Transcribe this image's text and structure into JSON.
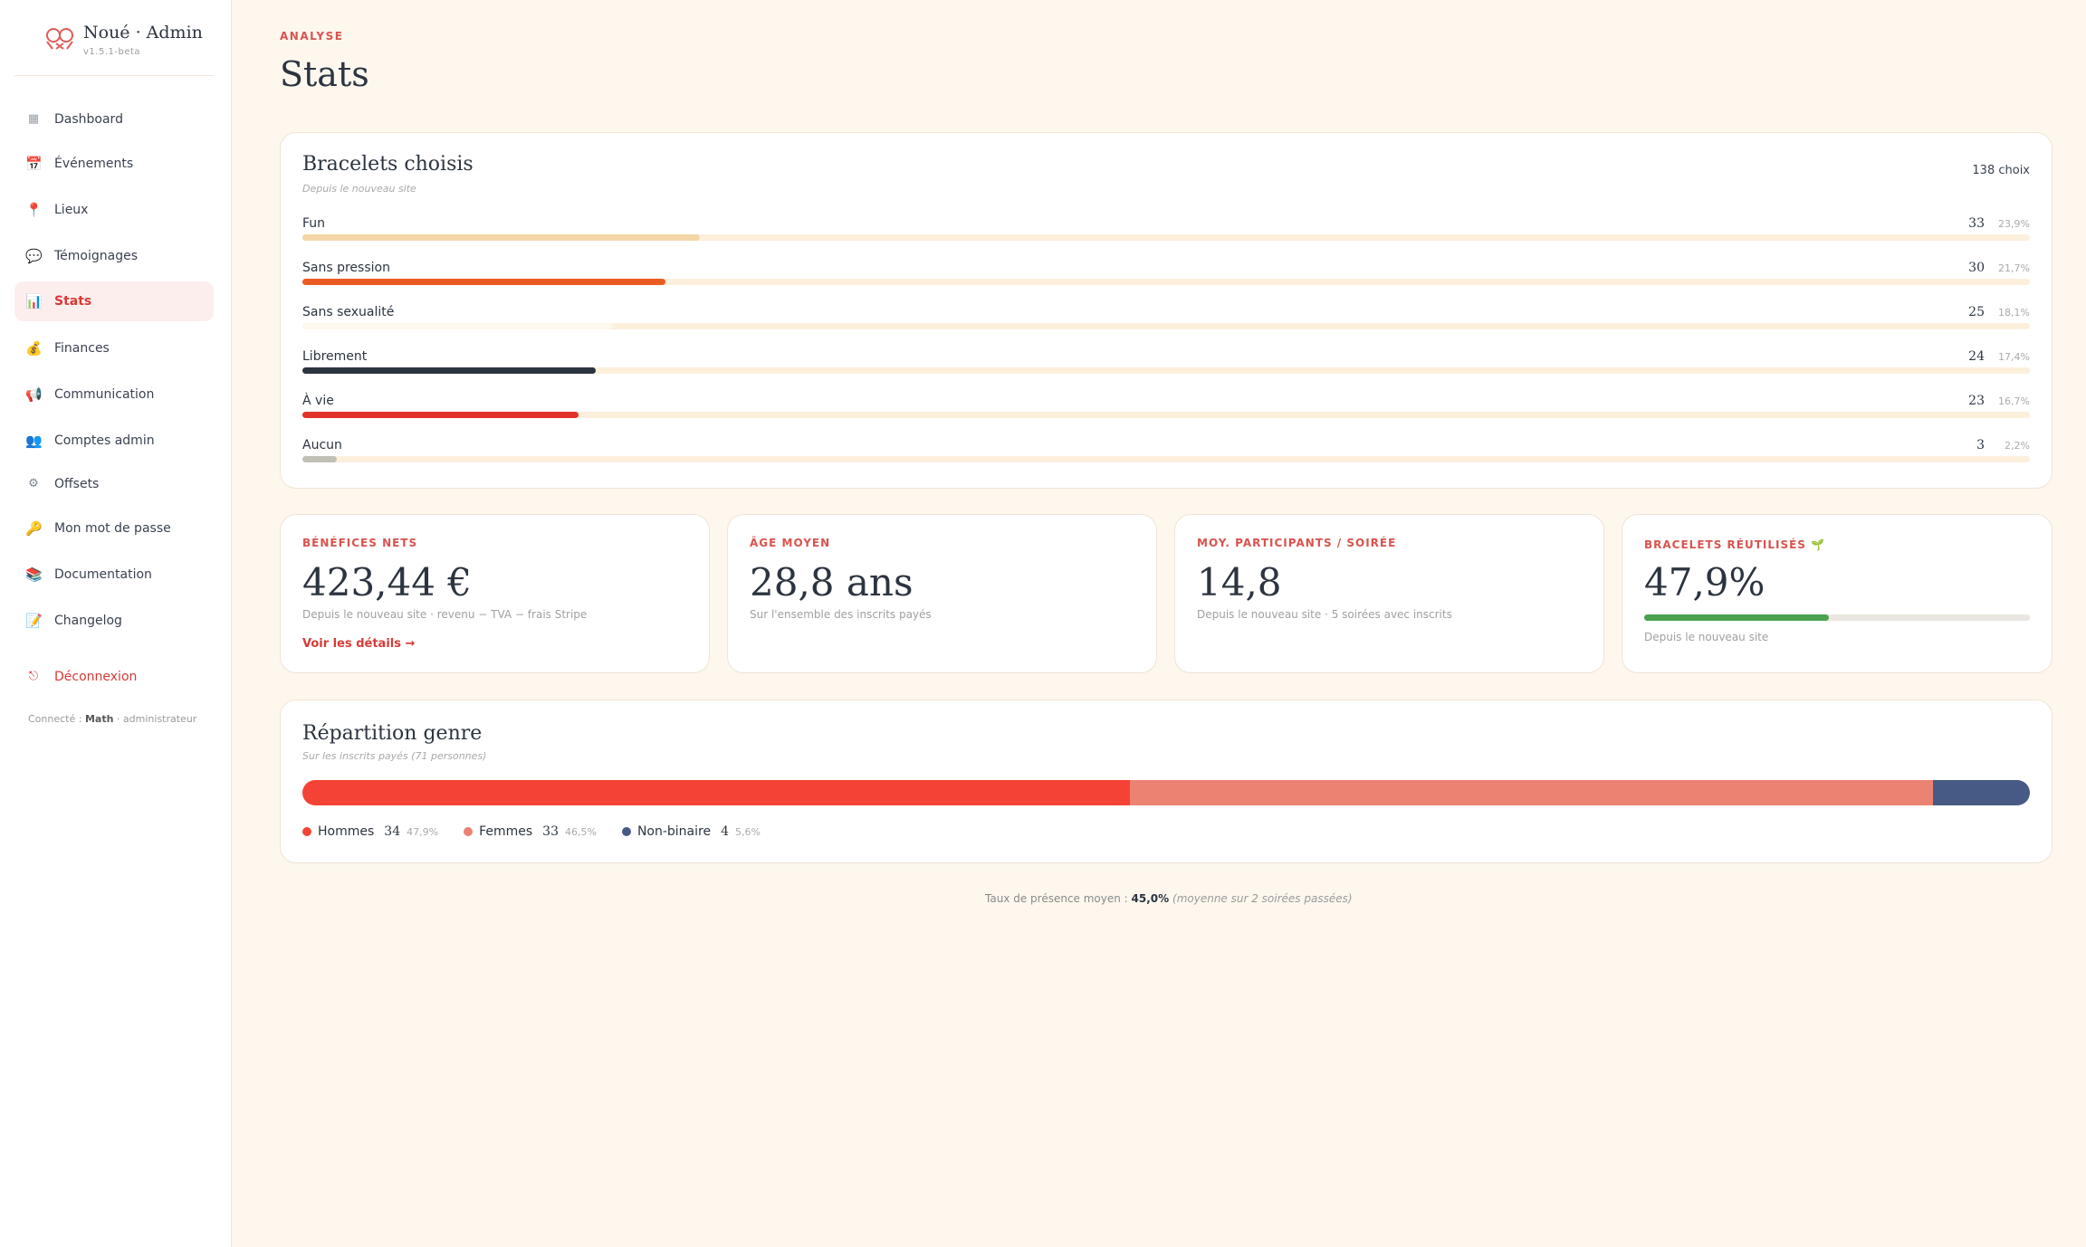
{
  "sidebar": {
    "brand_title": "Noué · Admin",
    "brand_version": "v1.5.1-beta",
    "items": [
      {
        "label": "Dashboard",
        "icon": "▦"
      },
      {
        "label": "Événements",
        "icon": "📅"
      },
      {
        "label": "Lieux",
        "icon": "📍"
      },
      {
        "label": "Témoignages",
        "icon": "💬"
      },
      {
        "label": "Stats",
        "icon": "📊"
      },
      {
        "label": "Finances",
        "icon": "💰"
      },
      {
        "label": "Communication",
        "icon": "📢"
      },
      {
        "label": "Comptes admin",
        "icon": "👥"
      },
      {
        "label": "Offsets",
        "icon": "⚙"
      },
      {
        "label": "Mon mot de passe",
        "icon": "🔑"
      },
      {
        "label": "Documentation",
        "icon": "📚"
      },
      {
        "label": "Changelog",
        "icon": "📝"
      }
    ],
    "logout": {
      "label": "Déconnexion",
      "icon": "⎋"
    },
    "connected_prefix": "Connecté :",
    "connected_user": "Math",
    "connected_role": "· administrateur"
  },
  "page": {
    "eyebrow": "ANALYSE",
    "title": "Stats"
  },
  "bracelets": {
    "title": "Bracelets choisis",
    "subtitle": "Depuis le nouveau site",
    "total": "138 choix",
    "rows": [
      {
        "label": "Fun",
        "count": "33",
        "pct": "23,9%",
        "share": 0.23,
        "color": "#f3d6a6"
      },
      {
        "label": "Sans pression",
        "count": "30",
        "pct": "21,7%",
        "share": 0.21,
        "color": "#ec5a24"
      },
      {
        "label": "Sans sexualité",
        "count": "25",
        "pct": "18,1%",
        "share": 0.18,
        "color": "#fdf7ee"
      },
      {
        "label": "Librement",
        "count": "24",
        "pct": "17,4%",
        "share": 0.17,
        "color": "#2c3440"
      },
      {
        "label": "À vie",
        "count": "23",
        "pct": "16,7%",
        "share": 0.16,
        "color": "#e3312b"
      },
      {
        "label": "Aucun",
        "count": "3",
        "pct": "2,2%",
        "share": 0.02,
        "color": "#c2bfb5"
      }
    ]
  },
  "kpis": {
    "benefices": {
      "label": "BÉNÉFICES NETS",
      "value": "423,44 €",
      "sub": "Depuis le nouveau site · revenu − TVA − frais Stripe",
      "link": "Voir les détails →"
    },
    "age": {
      "label": "ÂGE MOYEN",
      "value": "28,8 ans",
      "sub": "Sur l'ensemble des inscrits payés"
    },
    "participants": {
      "label": "MOY. PARTICIPANTS / SOIRÉE",
      "value": "14,8",
      "sub": "Depuis le nouveau site · 5 soirées avec inscrits"
    },
    "reutilises": {
      "label": "BRACELETS RÉUTILISÉS 🌱",
      "value": "47,9%",
      "sub": "Depuis le nouveau site",
      "share": 0.479
    }
  },
  "genre": {
    "title": "Répartition genre",
    "subtitle": "Sur les inscrits payés (71 personnes)",
    "segments": [
      {
        "label": "Hommes",
        "count": "34",
        "pct": "47,9%",
        "share": 0.479,
        "color": "#f44336"
      },
      {
        "label": "Femmes",
        "count": "33",
        "pct": "46,5%",
        "share": 0.465,
        "color": "#ec8272"
      },
      {
        "label": "Non-binaire",
        "count": "4",
        "pct": "5,6%",
        "share": 0.056,
        "color": "#475a86"
      }
    ]
  },
  "footer": {
    "prefix": "Taux de présence moyen :",
    "value": "45,0%",
    "note": "(moyenne sur 2 soirées passées)"
  }
}
